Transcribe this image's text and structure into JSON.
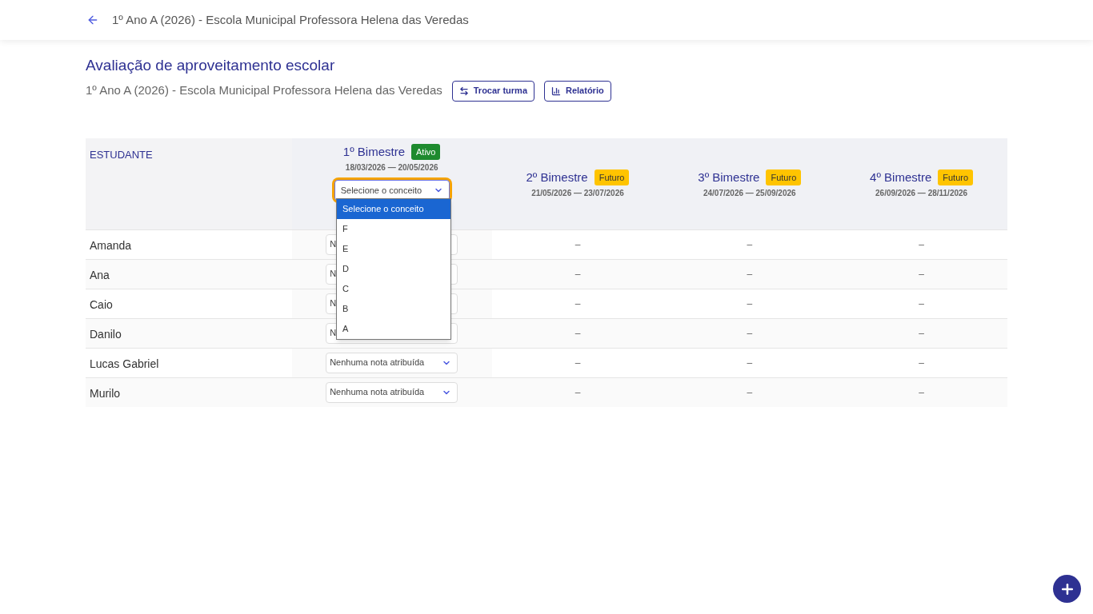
{
  "top_bar": {
    "title": "1º Ano A (2026) - Escola Municipal Professora Helena das Veredas"
  },
  "page": {
    "title": "Avaliação de aproveitamento escolar",
    "subtitle": "1º Ano A (2026) - Escola Municipal Professora Helena das Veredas",
    "buttons": [
      {
        "label": "Trocar turma",
        "kind": "swap"
      },
      {
        "label": "Relatório",
        "kind": "chart"
      }
    ]
  },
  "table": {
    "student_header": "ESTUDANTE",
    "periods": [
      {
        "name": "1º Bimestre",
        "badge": {
          "label": "Ativo",
          "kind": "active"
        },
        "dates": "18/03/2026 — 20/05/2026",
        "select": {
          "value": "Selecione o conceito",
          "focused": true,
          "open": true
        }
      },
      {
        "name": "2º Bimestre",
        "badge": {
          "label": "Futuro",
          "kind": "future"
        },
        "dates": "21/05/2026 — 23/07/2026"
      },
      {
        "name": "3º Bimestre",
        "badge": {
          "label": "Futuro",
          "kind": "future"
        },
        "dates": "24/07/2026 — 25/09/2026"
      },
      {
        "name": "4º Bimestre",
        "badge": {
          "label": "Futuro",
          "kind": "future"
        },
        "dates": "26/09/2026 — 28/11/2026"
      }
    ],
    "rows": [
      {
        "name": "Amanda",
        "grade": "N",
        "cells": [
          "–",
          "–",
          "–"
        ]
      },
      {
        "name": "Ana",
        "grade": "N",
        "cells": [
          "–",
          "–",
          "–"
        ]
      },
      {
        "name": "Caio",
        "grade": "N",
        "cells": [
          "–",
          "–",
          "–"
        ]
      },
      {
        "name": "Danilo",
        "grade": "N",
        "cells": [
          "–",
          "–",
          "–"
        ]
      },
      {
        "name": "Lucas Gabriel",
        "grade": "Nenhuma nota atribuída",
        "cells": [
          "–",
          "–",
          "–"
        ]
      },
      {
        "name": "Murilo",
        "grade": "Nenhuma nota atribuída",
        "cells": [
          "–",
          "–",
          "–"
        ]
      }
    ]
  },
  "dropdown": {
    "options": [
      {
        "label": "Selecione o conceito",
        "selected": true
      },
      {
        "label": "F",
        "selected": false
      },
      {
        "label": "E",
        "selected": false
      },
      {
        "label": "D",
        "selected": false
      },
      {
        "label": "C",
        "selected": false
      },
      {
        "label": "B",
        "selected": false
      },
      {
        "label": "A",
        "selected": false
      }
    ]
  }
}
